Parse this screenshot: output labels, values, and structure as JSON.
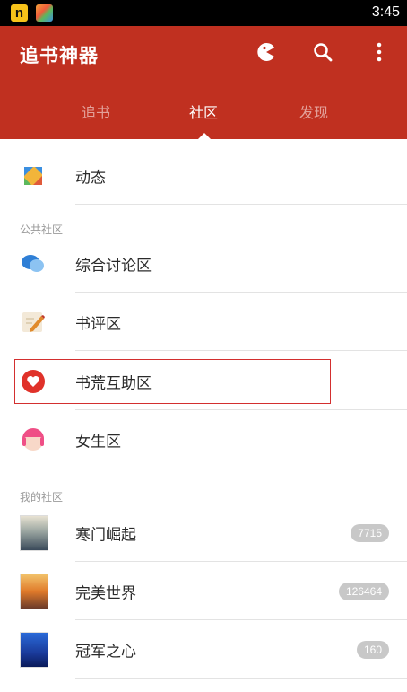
{
  "status_bar": {
    "notification_icons": [
      "n-app-icon",
      "game-app-icon"
    ],
    "n_glyph": "n",
    "time": "3:45"
  },
  "app_bar": {
    "title": "追书神器",
    "actions": [
      "pacman-icon",
      "search-icon",
      "more-vert-icon"
    ],
    "tabs": [
      {
        "label": "追书",
        "active": false
      },
      {
        "label": "社区",
        "active": true
      },
      {
        "label": "发现",
        "active": false
      }
    ]
  },
  "list": {
    "feed": {
      "label": "动态",
      "icon": "feed-diamond-icon"
    },
    "public_section": {
      "title": "公共社区",
      "items": [
        {
          "label": "综合讨论区",
          "icon": "chat-bubbles-icon"
        },
        {
          "label": "书评区",
          "icon": "pencil-note-icon"
        },
        {
          "label": "书荒互助区",
          "icon": "heart-circle-icon",
          "highlighted": true
        },
        {
          "label": "女生区",
          "icon": "girl-face-icon"
        }
      ]
    },
    "my_section": {
      "title": "我的社区",
      "items": [
        {
          "label": "寒门崛起",
          "count": "7715",
          "icon": "book-cover-1"
        },
        {
          "label": "完美世界",
          "count": "126464",
          "icon": "book-cover-2"
        },
        {
          "label": "冠军之心",
          "count": "160",
          "icon": "book-cover-3"
        }
      ]
    }
  },
  "colors": {
    "primary": "#c03020",
    "highlight_border": "#d32f2f",
    "badge_bg": "#c8c8c8"
  }
}
